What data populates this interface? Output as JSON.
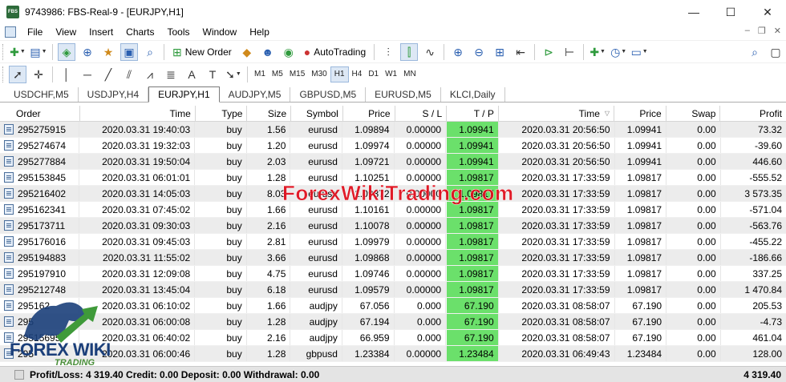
{
  "window": {
    "icon_text": "FBS",
    "title": "9743986: FBS-Real-9 - [EURJPY,H1]",
    "minimize": "—",
    "maximize": "☐",
    "close": "✕"
  },
  "menu": {
    "items": [
      "File",
      "View",
      "Insert",
      "Charts",
      "Tools",
      "Window",
      "Help"
    ],
    "mdi": [
      "–",
      "❐",
      "✕"
    ]
  },
  "toolbar": {
    "new_order_label": "New Order",
    "autotrading_label": "AutoTrading",
    "timeframes": [
      "M1",
      "M5",
      "M15",
      "M30",
      "H1",
      "H4",
      "D1",
      "W1",
      "MN"
    ],
    "active_timeframe": "H1"
  },
  "tabs": [
    "USDCHF,M5",
    "USDJPY,H4",
    "EURJPY,H1",
    "AUDJPY,M5",
    "GBPUSD,M5",
    "EURUSD,M5",
    "KLCI,Daily"
  ],
  "active_tab": "EURJPY,H1",
  "table": {
    "headers": {
      "order": "Order",
      "time": "Time",
      "type": "Type",
      "size": "Size",
      "symbol": "Symbol",
      "price": "Price",
      "sl": "S / L",
      "tp": "T / P",
      "time2": "Time",
      "price2": "Price",
      "swap": "Swap",
      "profit": "Profit"
    },
    "rows": [
      [
        "295275915",
        "2020.03.31 19:40:03",
        "buy",
        "1.56",
        "eurusd",
        "1.09894",
        "0.00000",
        "1.09941",
        "2020.03.31 20:56:50",
        "1.09941",
        "0.00",
        "73.32"
      ],
      [
        "295274674",
        "2020.03.31 19:32:03",
        "buy",
        "1.20",
        "eurusd",
        "1.09974",
        "0.00000",
        "1.09941",
        "2020.03.31 20:56:50",
        "1.09941",
        "0.00",
        "-39.60"
      ],
      [
        "295277884",
        "2020.03.31 19:50:04",
        "buy",
        "2.03",
        "eurusd",
        "1.09721",
        "0.00000",
        "1.09941",
        "2020.03.31 20:56:50",
        "1.09941",
        "0.00",
        "446.60"
      ],
      [
        "295153845",
        "2020.03.31 06:01:01",
        "buy",
        "1.28",
        "eurusd",
        "1.10251",
        "0.00000",
        "1.09817",
        "2020.03.31 17:33:59",
        "1.09817",
        "0.00",
        "-555.52"
      ],
      [
        "295216402",
        "2020.03.31 14:05:03",
        "buy",
        "8.03",
        "eurusd",
        "1.09372",
        "0.00000",
        "1.09817",
        "2020.03.31 17:33:59",
        "1.09817",
        "0.00",
        "3 573.35"
      ],
      [
        "295162341",
        "2020.03.31 07:45:02",
        "buy",
        "1.66",
        "eurusd",
        "1.10161",
        "0.00000",
        "1.09817",
        "2020.03.31 17:33:59",
        "1.09817",
        "0.00",
        "-571.04"
      ],
      [
        "295173711",
        "2020.03.31 09:30:03",
        "buy",
        "2.16",
        "eurusd",
        "1.10078",
        "0.00000",
        "1.09817",
        "2020.03.31 17:33:59",
        "1.09817",
        "0.00",
        "-563.76"
      ],
      [
        "295176016",
        "2020.03.31 09:45:03",
        "buy",
        "2.81",
        "eurusd",
        "1.09979",
        "0.00000",
        "1.09817",
        "2020.03.31 17:33:59",
        "1.09817",
        "0.00",
        "-455.22"
      ],
      [
        "295194883",
        "2020.03.31 11:55:02",
        "buy",
        "3.66",
        "eurusd",
        "1.09868",
        "0.00000",
        "1.09817",
        "2020.03.31 17:33:59",
        "1.09817",
        "0.00",
        "-186.66"
      ],
      [
        "295197910",
        "2020.03.31 12:09:08",
        "buy",
        "4.75",
        "eurusd",
        "1.09746",
        "0.00000",
        "1.09817",
        "2020.03.31 17:33:59",
        "1.09817",
        "0.00",
        "337.25"
      ],
      [
        "295212748",
        "2020.03.31 13:45:04",
        "buy",
        "6.18",
        "eurusd",
        "1.09579",
        "0.00000",
        "1.09817",
        "2020.03.31 17:33:59",
        "1.09817",
        "0.00",
        "1 470.84"
      ],
      [
        "295162",
        "2020.03.31 06:10:02",
        "buy",
        "1.66",
        "audjpy",
        "67.056",
        "0.000",
        "67.190",
        "2020.03.31 08:58:07",
        "67.190",
        "0.00",
        "205.53"
      ],
      [
        "295",
        "2020.03.31 06:00:08",
        "buy",
        "1.28",
        "audjpy",
        "67.194",
        "0.000",
        "67.190",
        "2020.03.31 08:58:07",
        "67.190",
        "0.00",
        "-4.73"
      ],
      [
        "295156957",
        "2020.03.31 06:40:02",
        "buy",
        "2.16",
        "audjpy",
        "66.959",
        "0.000",
        "67.190",
        "2020.03.31 08:58:07",
        "67.190",
        "0.00",
        "461.04"
      ],
      [
        "295",
        "2020.03.31 06:00:46",
        "buy",
        "1.28",
        "gbpusd",
        "1.23384",
        "0.00000",
        "1.23484",
        "2020.03.31 06:49:43",
        "1.23484",
        "0.00",
        "128.00"
      ]
    ]
  },
  "status": {
    "summary": "Profit/Loss: 4 319.40  Credit: 0.00  Deposit: 0.00  Withdrawal: 0.00",
    "total": "4 319.40"
  },
  "watermark": {
    "site": "ForexWikiTrading.com",
    "logo_main": "FOREX WIKI",
    "logo_sub": "TRADING"
  },
  "colors": {
    "tp_highlight": "#6be06b",
    "watermark_red": "#e0101e",
    "logo_blue": "#1b3f7a",
    "logo_green": "#4a8f3a"
  }
}
